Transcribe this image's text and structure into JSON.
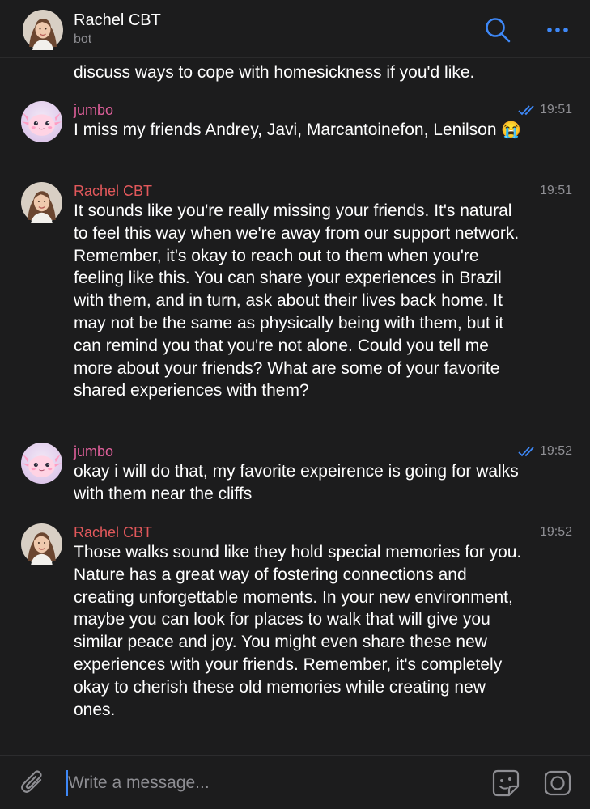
{
  "header": {
    "title": "Rachel CBT",
    "subtitle": "bot"
  },
  "chat": {
    "partial_message": "discuss ways to cope with homesickness if you'd like.",
    "messages": [
      {
        "sender": "jumbo",
        "time": "19:51",
        "read": true,
        "text": "I miss my friends Andrey, Javi, Marcantoinefon, Lenilson",
        "emoji": "😭"
      },
      {
        "sender": "Rachel CBT",
        "time": "19:51",
        "read": false,
        "text": "It sounds like you're really missing your friends. It's natural to feel this way when we're away from our support network. Remember, it's okay to reach out to them when you're feeling like this. You can share your experiences in Brazil with them, and in turn, ask about their lives back home. It may not be the same as physically being with them, but it can remind you that you're not alone. Could you tell me more about your friends? What are some of your favorite shared experiences with them?"
      },
      {
        "sender": "jumbo",
        "time": "19:52",
        "read": true,
        "text": "okay i will do that, my favorite expeirence is going for walks with them near the cliffs"
      },
      {
        "sender": "Rachel CBT",
        "time": "19:52",
        "read": false,
        "text": "Those walks sound like they hold special memories for you. Nature has a great way of fostering connections and creating unforgettable moments. In your new environment, maybe you can look for places to walk that will give you similar peace and joy. You might even share these new experiences with your friends. Remember, it's completely okay to cherish these old memories while creating new ones."
      }
    ]
  },
  "input": {
    "placeholder": "Write a message..."
  },
  "colors": {
    "background": "#1c1c1d",
    "accent": "#3e88f7",
    "bot_name": "#e1585b",
    "user_name": "#e0609b",
    "muted": "#8e8e93"
  },
  "icons": {
    "search": "search-icon",
    "more": "more-icon",
    "attach": "paperclip-icon",
    "sticker": "sticker-icon",
    "camera": "camera-icon"
  }
}
